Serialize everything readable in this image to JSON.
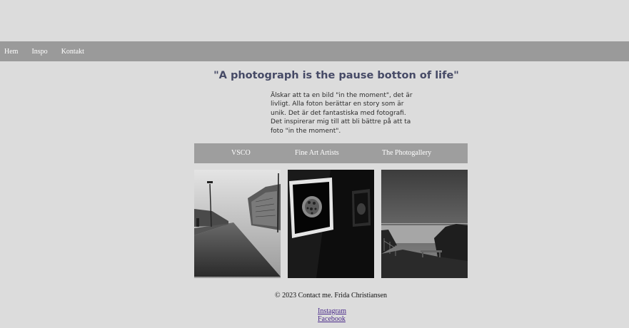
{
  "nav": {
    "items": [
      {
        "label": "Hem"
      },
      {
        "label": "Inspo"
      },
      {
        "label": "Kontakt"
      }
    ]
  },
  "hero": {
    "quote": "\"A photograph is the pause botton of life\"",
    "intro": "Älskar att ta en bild \"in the moment\", det är livligt. Alla foton berättar en story som är unik. Det är det fantastiska med fotografi. Det inspirerar mig till att bli bättre på att ta foto \"in the moment\"."
  },
  "links": {
    "items": [
      {
        "label": "VSCO"
      },
      {
        "label": "Fine Art Artists"
      },
      {
        "label": "The Photogallery"
      }
    ]
  },
  "gallery": {
    "photos": [
      {
        "subject": "city-street-photo"
      },
      {
        "subject": "framed-leopard-gallery-photo"
      },
      {
        "subject": "seaside-bench-photo"
      }
    ]
  },
  "footer": {
    "text": "© 2023 Contact me. Frida Christiansen",
    "instagram": "Instagram",
    "facebook": "Facebook"
  }
}
